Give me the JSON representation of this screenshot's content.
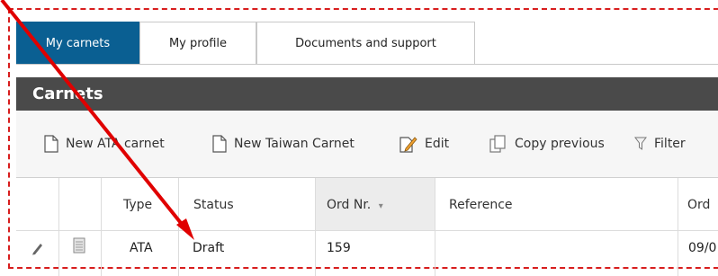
{
  "tabs": [
    {
      "label": "My carnets",
      "active": true
    },
    {
      "label": "My profile",
      "active": false
    },
    {
      "label": "Documents and support",
      "active": false
    }
  ],
  "section": {
    "title": "Carnets"
  },
  "toolbar": {
    "new_ata": "New ATA carnet",
    "new_taiwan": "New Taiwan Carnet",
    "edit": "Edit",
    "copy_previous": "Copy previous",
    "filter": "Filter"
  },
  "table": {
    "headers": {
      "type": "Type",
      "status": "Status",
      "ord_nr": "Ord Nr.",
      "sort_glyph": "▾",
      "reference": "Reference",
      "ord": "Ord"
    },
    "rows": [
      {
        "type": "ATA",
        "status": "Draft",
        "ord_nr": "159",
        "reference": "",
        "ord": "09/0"
      }
    ]
  },
  "colors": {
    "accent": "#0a5f92",
    "section_bar": "#4a4a4a",
    "annotation": "#e00000"
  },
  "icons": [
    "document-icon",
    "edit-icon",
    "copy-icon",
    "filter-icon",
    "pencil-icon",
    "notes-icon",
    "sort-descending-icon"
  ]
}
